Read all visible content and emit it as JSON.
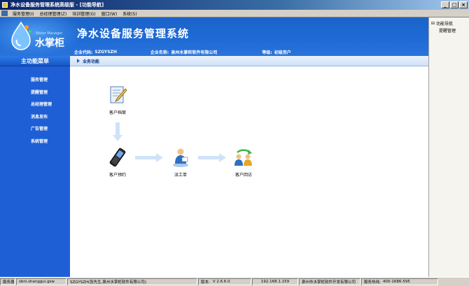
{
  "window": {
    "title": "净水设备服务管理系统高级版 - [功能导航]",
    "buttons": [
      "_",
      "□",
      "×"
    ]
  },
  "menu": [
    "服务管理(I)",
    "总经理管理(Z)",
    "培训管理(G)",
    "窗口(W)",
    "系统(S)"
  ],
  "header": {
    "logo_text": "水掌柜",
    "logo_sub": "Water Manager",
    "app_title": "净水设备服务管理系统",
    "company_code_label": "企业代码:",
    "company_code": "SZGYSZH",
    "company_name_label": "企业名称:",
    "company_name": "泉州水掌柜软件有限公司",
    "level_label": "等级:",
    "level": "初级用户"
  },
  "sidebar": {
    "title": "主功能菜单",
    "items": [
      {
        "label": "服务管理"
      },
      {
        "label": "提醒管理"
      },
      {
        "label": "总经理管理"
      },
      {
        "label": "消息发布"
      },
      {
        "label": "广告管理"
      },
      {
        "label": "系统管理"
      }
    ]
  },
  "content": {
    "title": "业务功能",
    "nodes": [
      {
        "label": "客户档案",
        "icon": "document-edit-icon"
      },
      {
        "label": "客户预约",
        "icon": "phone-icon"
      },
      {
        "label": "派工单",
        "icon": "worker-icon"
      },
      {
        "label": "客户回访",
        "icon": "people-cycle-icon"
      }
    ]
  },
  "right_panel": {
    "items": [
      {
        "label": "功能导航"
      },
      {
        "label": "提醒管理"
      }
    ]
  },
  "status": {
    "server_label": "服务器",
    "server": "sbni.shanggui.gsw",
    "user": "SZGYSZH(张先生,泉州水掌柜软件有限公司)",
    "version_label": "版本:",
    "version": "V 2.6.6.0",
    "ip": "192.168.1.159",
    "company": "泉州市水掌柜软件开发有限公司",
    "hotline_label": "服务热线:",
    "hotline": "400-1686-595"
  },
  "colors": {
    "brand_blue": "#1f5fd6",
    "header_blue": "#1b63c9",
    "arrow": "#cfe3f8"
  }
}
